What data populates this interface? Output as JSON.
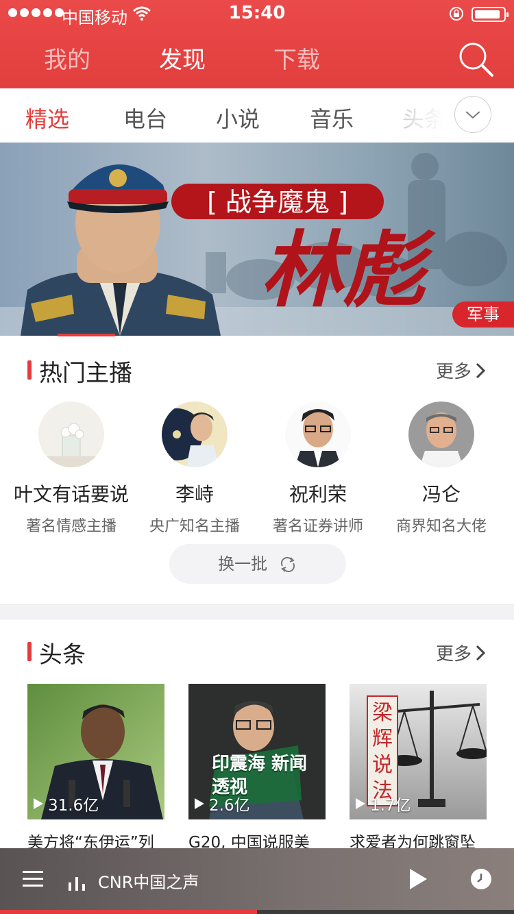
{
  "status": {
    "carrier": "中国移动",
    "time": "15:40",
    "battery_level": 0.9
  },
  "top_nav": [
    {
      "label": "我的",
      "active": false
    },
    {
      "label": "发现",
      "active": true
    },
    {
      "label": "下载",
      "active": false
    }
  ],
  "channels": [
    {
      "label": "精选"
    },
    {
      "label": "电台"
    },
    {
      "label": "小说"
    },
    {
      "label": "音乐"
    },
    {
      "label": "头条"
    }
  ],
  "banner": {
    "headline": "[ 战争魔鬼 ]",
    "name": "林彪",
    "tag": "军事"
  },
  "hot_anchors": {
    "title": "热门主播",
    "more": "更多",
    "refresh": "换一批",
    "items": [
      {
        "name": "叶文有话要说",
        "desc": "著名情感主播"
      },
      {
        "name": "李峙",
        "desc": "央广知名主播"
      },
      {
        "name": "祝利荣",
        "desc": "著名证券讲师"
      },
      {
        "name": "冯仑",
        "desc": "商界知名大佬"
      }
    ]
  },
  "headlines": {
    "title": "头条",
    "more": "更多",
    "items": [
      {
        "plays": "31.6亿",
        "title": "美方将“东伊运”列",
        "overlay": ""
      },
      {
        "plays": "2.6亿",
        "title": "G20, 中国说服美",
        "overlay": "印震海 新闻透视"
      },
      {
        "plays": "1.7亿",
        "title": "求爱者为何跳窗坠",
        "overlay": "梁辉说法"
      }
    ]
  },
  "player": {
    "station": "CNR中国之声",
    "progress": 0.5
  },
  "colors": {
    "accent": "#e43c3c",
    "header": "#e54444"
  }
}
